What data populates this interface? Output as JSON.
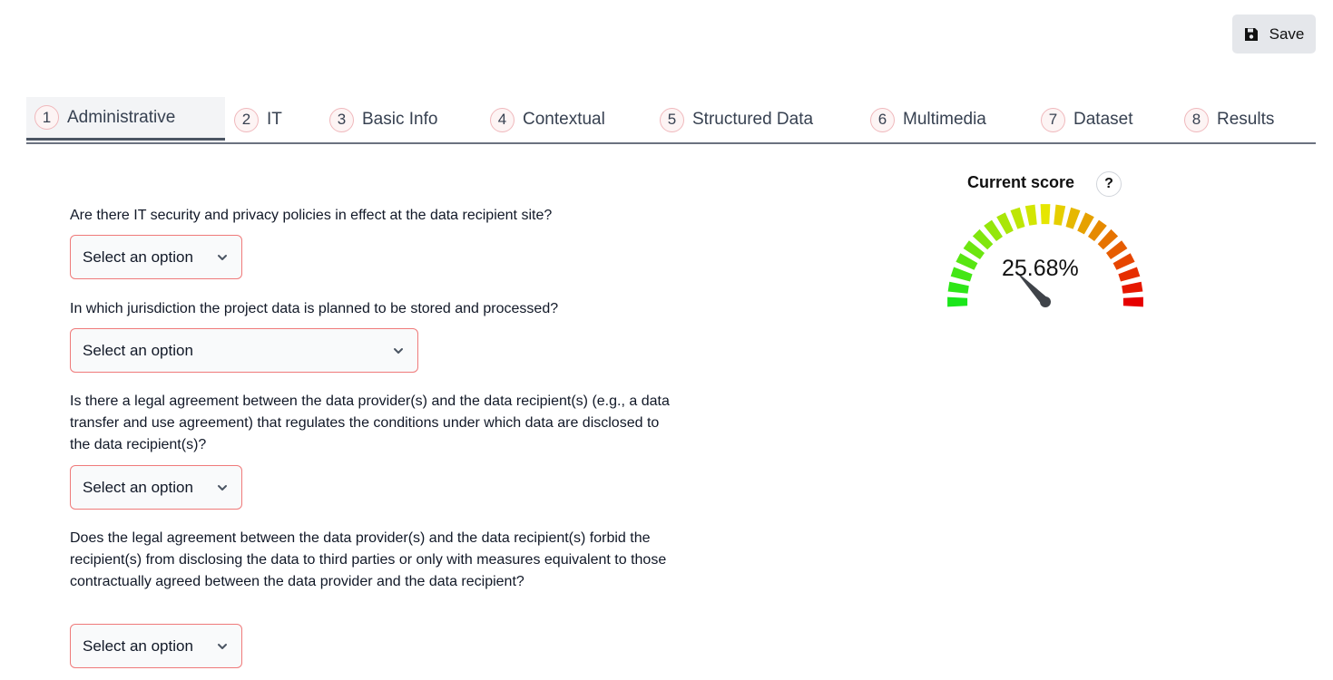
{
  "toolbar": {
    "save_label": "Save"
  },
  "tabs": [
    {
      "num": "1",
      "label": "Administrative",
      "active": true
    },
    {
      "num": "2",
      "label": "IT"
    },
    {
      "num": "3",
      "label": "Basic Info"
    },
    {
      "num": "4",
      "label": "Contextual"
    },
    {
      "num": "5",
      "label": "Structured Data"
    },
    {
      "num": "6",
      "label": "Multimedia"
    },
    {
      "num": "7",
      "label": "Dataset"
    },
    {
      "num": "8",
      "label": "Results"
    }
  ],
  "questions": [
    {
      "text": "Are there IT security and privacy policies in effect at the data recipient site?",
      "value": "Select an option"
    },
    {
      "text": "In which jurisdiction the project data is planned to be stored and processed?",
      "value": "Select an option"
    },
    {
      "text": "Is there a legal agreement between the data provider(s) and the data recipient(s) (e.g., a data transfer and use agreement) that regulates the conditions under which data are disclosed to the data recipient(s)?",
      "value": "Select an option"
    },
    {
      "text": "Does the legal agreement between the data provider(s) and the data recipient(s) forbid the recipient(s) from disclosing the data to third parties or only with measures equivalent to those contractually agreed between the data provider and the data recipient?",
      "value": "Select an option"
    }
  ],
  "score": {
    "title": "Current score",
    "help": "?",
    "value": "25.68%",
    "fraction": 0.2568,
    "colors": [
      "#1ae61a",
      "#e6e600",
      "#e60000"
    ]
  }
}
